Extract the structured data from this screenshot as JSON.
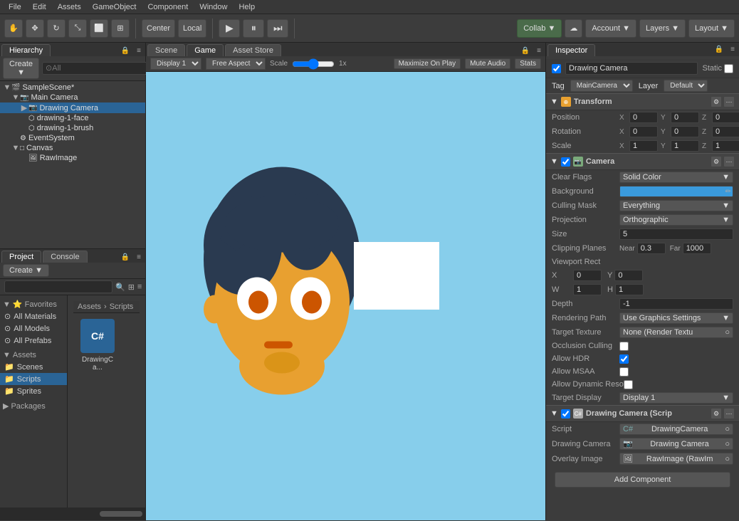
{
  "menubar": {
    "items": [
      "File",
      "Edit",
      "Assets",
      "GameObject",
      "Component",
      "Window",
      "Help"
    ]
  },
  "toolbar": {
    "tools": [
      "hand",
      "move",
      "rotate",
      "scale",
      "rect",
      "transform"
    ],
    "center_label": "Center",
    "local_label": "Local",
    "play_label": "▶",
    "pause_label": "⏸",
    "step_label": "⏭",
    "collab_label": "Collab ▼",
    "cloud_label": "☁",
    "account_label": "Account ▼",
    "layers_label": "Layers ▼",
    "layout_label": "Layout ▼"
  },
  "hierarchy": {
    "title": "Hierarchy",
    "create_label": "Create ▼",
    "search_placeholder": "⊙All",
    "items": [
      {
        "name": "SampleScene*",
        "level": 0,
        "expanded": true,
        "type": "scene"
      },
      {
        "name": "Main Camera",
        "level": 1,
        "expanded": true,
        "type": "camera"
      },
      {
        "name": "Drawing Camera",
        "level": 2,
        "expanded": false,
        "type": "camera",
        "selected": true
      },
      {
        "name": "drawing-1-face",
        "level": 2,
        "expanded": false,
        "type": "mesh"
      },
      {
        "name": "drawing-1-brush",
        "level": 2,
        "expanded": false,
        "type": "mesh"
      },
      {
        "name": "EventSystem",
        "level": 1,
        "expanded": false,
        "type": "event"
      },
      {
        "name": "Canvas",
        "level": 1,
        "expanded": true,
        "type": "canvas"
      },
      {
        "name": "RawImage",
        "level": 2,
        "expanded": false,
        "type": "image"
      }
    ]
  },
  "scene_view": {
    "tabs": [
      "Scene",
      "Game",
      "Asset Store"
    ],
    "active_tab": "Game",
    "display_label": "Display 1",
    "aspect_label": "Free Aspect",
    "scale_label": "Scale",
    "scale_value": "1x",
    "maximize_label": "Maximize On Play",
    "mute_label": "Mute Audio",
    "stats_label": "Stats"
  },
  "project": {
    "tabs": [
      "Project",
      "Console"
    ],
    "active_tab": "Project",
    "create_label": "Create ▼",
    "search_placeholder": "",
    "breadcrumb": [
      "Assets",
      "Scripts"
    ],
    "favorites": {
      "title": "Favorites",
      "items": [
        "All Materials",
        "All Models",
        "All Prefabs"
      ]
    },
    "assets": {
      "title": "Assets",
      "items": [
        "Scenes",
        "Scripts",
        "Sprites",
        "Packages"
      ]
    },
    "file": {
      "name": "DrawingCa...",
      "type": "cs"
    }
  },
  "inspector": {
    "tab_label": "Inspector",
    "object_name": "Drawing Camera",
    "enabled": true,
    "static_label": "Static",
    "tag_label": "Tag",
    "tag_value": "MainCamera",
    "layer_label": "Layer",
    "layer_value": "Default",
    "transform": {
      "title": "Transform",
      "position": {
        "x": "0",
        "y": "0",
        "z": "0"
      },
      "rotation": {
        "x": "0",
        "y": "0",
        "z": "0"
      },
      "scale": {
        "x": "1",
        "y": "1",
        "z": "1"
      }
    },
    "camera": {
      "title": "Camera",
      "clear_flags_label": "Clear Flags",
      "clear_flags_value": "Solid Color",
      "background_label": "Background",
      "background_color": "#3a9adc",
      "culling_mask_label": "Culling Mask",
      "culling_mask_value": "Everything",
      "projection_label": "Projection",
      "projection_value": "Orthographic",
      "size_label": "Size",
      "size_value": "5",
      "clipping_planes_label": "Clipping Planes",
      "near_label": "Near",
      "near_value": "0.3",
      "far_label": "Far",
      "far_value": "1000",
      "viewport_rect_label": "Viewport Rect",
      "viewport_x": "0",
      "viewport_y": "0",
      "viewport_w": "1",
      "viewport_h": "1",
      "depth_label": "Depth",
      "depth_value": "-1",
      "rendering_path_label": "Rendering Path",
      "rendering_path_value": "Use Graphics Settings",
      "target_texture_label": "Target Texture",
      "target_texture_value": "None (Render Textu",
      "occlusion_culling_label": "Occlusion Culling",
      "allow_hdr_label": "Allow HDR",
      "allow_hdr_value": true,
      "allow_msaa_label": "Allow MSAA",
      "allow_dynamic_label": "Allow Dynamic Reso",
      "target_display_label": "Target Display",
      "target_display_value": "Display 1"
    },
    "script_component": {
      "title": "Drawing Camera (Scrip",
      "script_label": "Script",
      "script_value": "DrawingCamera",
      "drawing_camera_label": "Drawing Camera",
      "drawing_camera_value": "Drawing Camera",
      "overlay_image_label": "Overlay Image",
      "overlay_image_value": "RawImage (RawIm"
    },
    "add_component_label": "Add Component"
  }
}
